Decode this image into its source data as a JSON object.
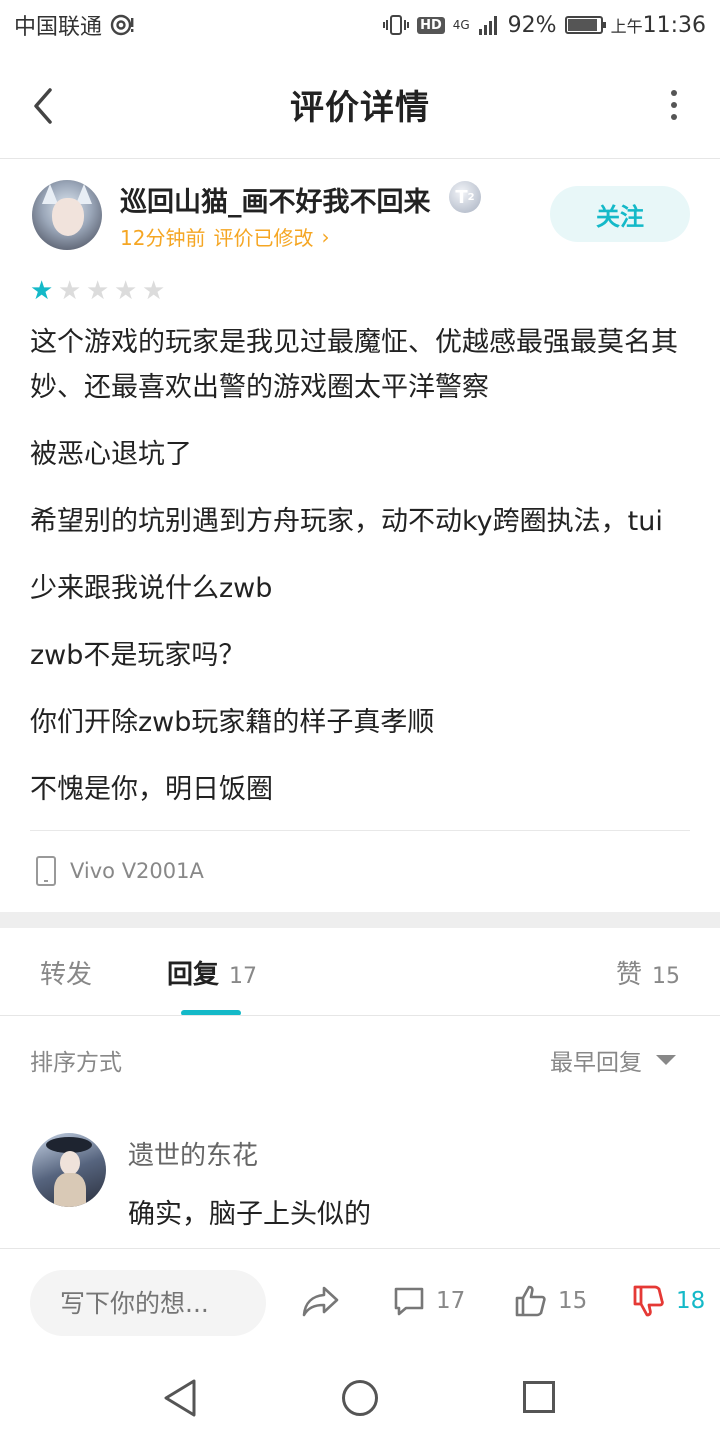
{
  "status_bar": {
    "carrier": "中国联通",
    "battery_percent": "92%",
    "battery_level": 0.92,
    "time_prefix": "上午",
    "time": "11:36",
    "hd": "HD",
    "network": "4G"
  },
  "header": {
    "title": "评价详情"
  },
  "author": {
    "name": "巡回山猫_画不好我不回来",
    "badge": "T",
    "badge_sub": "2",
    "time_ago": "12分钟前",
    "edited_label": "评价已修改",
    "edited_chevron": "›",
    "follow_label": "关注"
  },
  "rating": {
    "value": 1,
    "max": 5
  },
  "review": {
    "paragraphs": [
      "这个游戏的玩家是我见过最魔怔、优越感最强最莫名其妙、还最喜欢出警的游戏圈太平洋警察",
      "被恶心退坑了",
      "希望别的坑别遇到方舟玩家，动不动ky跨圈执法，tui",
      "少来跟我说什么zwb",
      "zwb不是玩家吗？",
      "你们开除zwb玩家籍的样子真孝顺",
      "不愧是你，明日饭圈"
    ]
  },
  "device": {
    "name": "Vivo V2001A",
    "icon": "phone-icon"
  },
  "tabs": [
    {
      "label": "转发",
      "count": ""
    },
    {
      "label": "回复",
      "count": "17"
    },
    {
      "label": "赞",
      "count": "15"
    }
  ],
  "sort": {
    "label": "排序方式",
    "selected": "最早回复"
  },
  "replies": [
    {
      "user": "遗世的东花",
      "text": "确实，脑子上头似的"
    }
  ],
  "bottom_bar": {
    "input_placeholder": "写下你的想...",
    "comment_count": "17",
    "like_count": "15",
    "dislike_count": "18"
  },
  "colors": {
    "accent": "#14b9c8",
    "meta_orange": "#f5a623",
    "dislike_red": "#e53935"
  }
}
